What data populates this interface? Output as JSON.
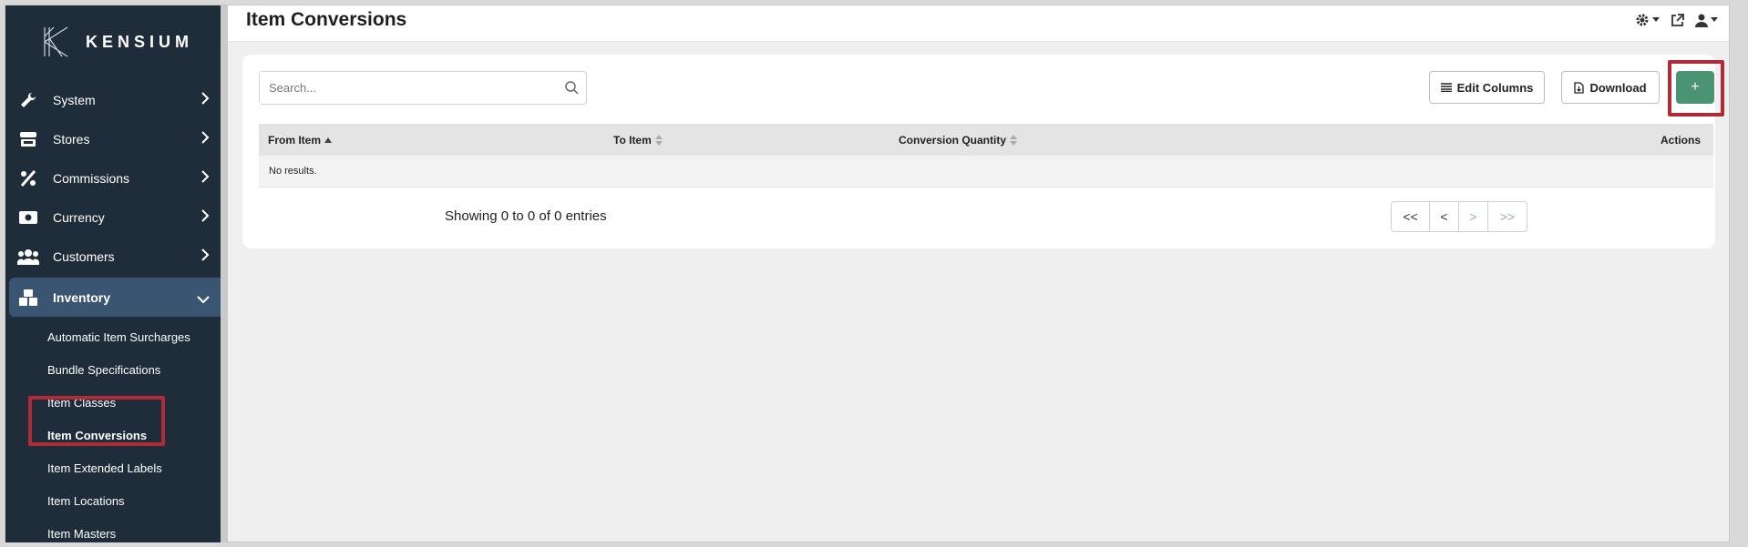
{
  "brand": {
    "name": "KENSIUM"
  },
  "header": {
    "title": "Item Conversions",
    "icons": [
      "gear-icon",
      "external-link-icon",
      "user-icon"
    ]
  },
  "sidebar": {
    "items": [
      {
        "label": "System",
        "icon": "wrench-icon"
      },
      {
        "label": "Stores",
        "icon": "store-icon"
      },
      {
        "label": "Commissions",
        "icon": "percent-icon"
      },
      {
        "label": "Currency",
        "icon": "money-icon"
      },
      {
        "label": "Customers",
        "icon": "users-icon"
      },
      {
        "label": "Inventory",
        "icon": "boxes-icon",
        "expanded": true
      }
    ],
    "subitems": [
      {
        "label": "Automatic Item Surcharges"
      },
      {
        "label": "Bundle Specifications"
      },
      {
        "label": "Item Classes"
      },
      {
        "label": "Item Conversions",
        "current": true
      },
      {
        "label": "Item Extended Labels"
      },
      {
        "label": "Item Locations"
      },
      {
        "label": "Item Masters"
      }
    ]
  },
  "toolbar": {
    "search_placeholder": "Search...",
    "edit_columns_label": "Edit Columns",
    "download_label": "Download",
    "add_label": "+"
  },
  "table": {
    "columns": [
      {
        "label": "From Item",
        "sort": "ascending"
      },
      {
        "label": "To Item",
        "sort": "none"
      },
      {
        "label": "Conversion Quantity",
        "sort": "none"
      },
      {
        "label": "Actions"
      }
    ],
    "empty_text": "No results."
  },
  "pagination": {
    "summary": "Showing 0 to 0 of 0 entries",
    "first_label": "<<",
    "prev_label": "<",
    "next_label": ">",
    "last_label": ">>"
  },
  "colors": {
    "sidebar_bg": "#1f2d3b",
    "active_item_bg": "#3a5572",
    "add_button": "#4a9474",
    "highlight": "#b02a37"
  }
}
